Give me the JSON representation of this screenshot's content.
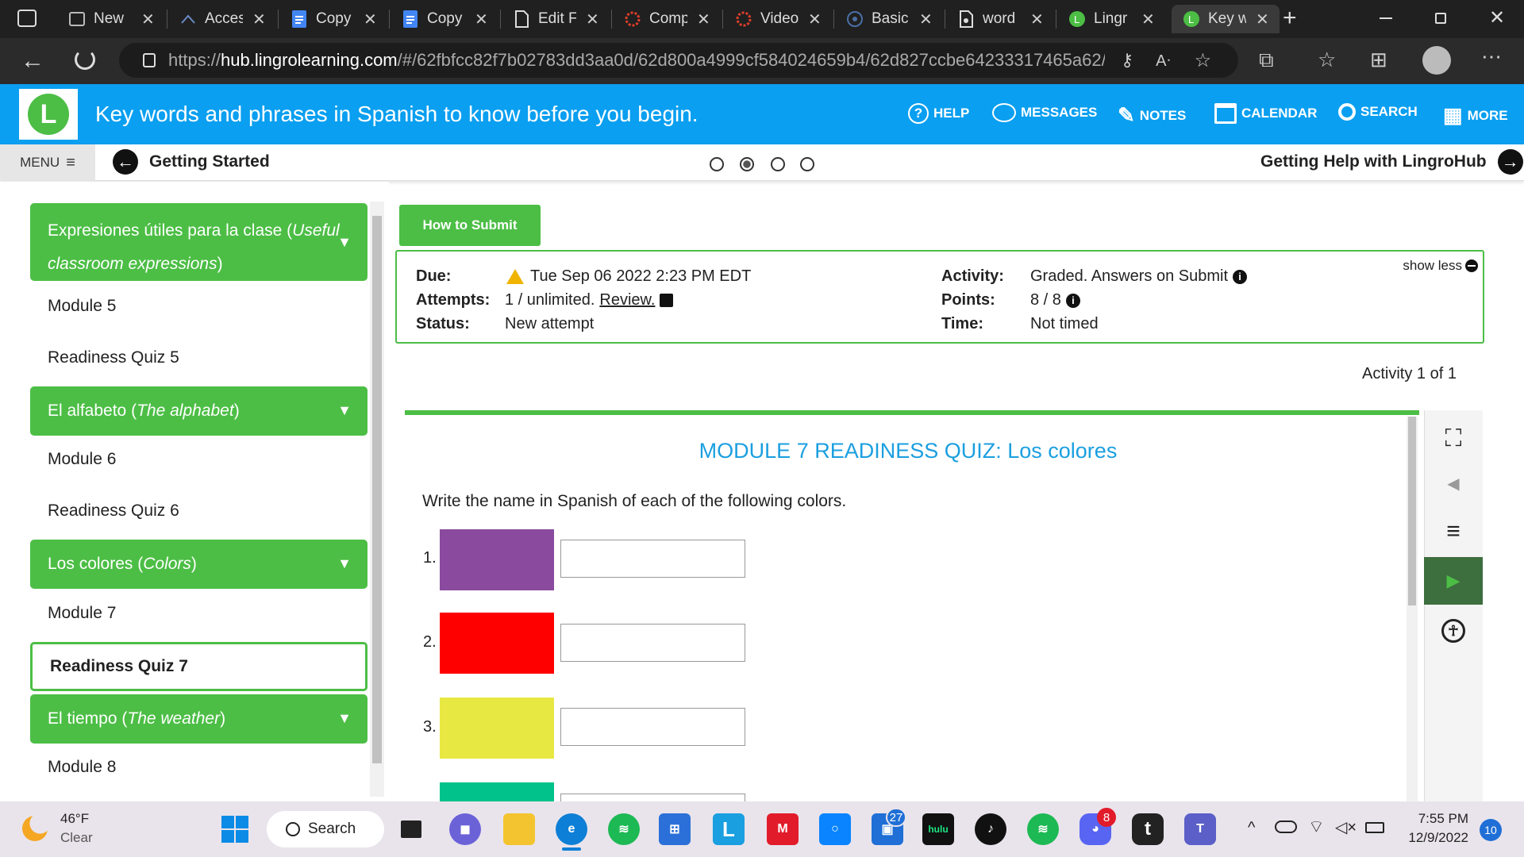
{
  "browser": {
    "tabs": [
      {
        "title": "New"
      },
      {
        "title": "Acces"
      },
      {
        "title": "Copy"
      },
      {
        "title": "Copy"
      },
      {
        "title": "Edit F"
      },
      {
        "title": "Comp"
      },
      {
        "title": "Video"
      },
      {
        "title": "Basic"
      },
      {
        "title": "word"
      },
      {
        "title": "Lingr"
      },
      {
        "title": "Key w"
      }
    ],
    "url_prefix": "https://",
    "url_host": "hub.lingrolearning.com",
    "url_path": "/#/62fbfcc82f7b02783dd3aa0d/62d800a4999cf584024659b4/62d827ccbe64233317465a62/6..."
  },
  "header": {
    "logo_letter": "L",
    "title": "Key words and phrases in Spanish to know before you begin.",
    "nav": [
      "HELP",
      "MESSAGES",
      "NOTES",
      "CALENDAR",
      "SEARCH",
      "MORE"
    ]
  },
  "subbar": {
    "menu_label": "MENU",
    "prev_label": "Getting Started",
    "next_label": "Getting Help with LingroHub"
  },
  "sidebar": {
    "groups": [
      {
        "label_plain": "Expresiones útiles para la clase (",
        "label_italic": "Useful",
        "label_line2_italic": "classroom expressions",
        "label_end": ")"
      },
      {
        "label_plain": "El alfabeto (",
        "label_italic": "The alphabet",
        "label_end": ")"
      },
      {
        "label_plain": "Los colores (",
        "label_italic": "Colors",
        "label_end": ")"
      },
      {
        "label_plain": "El tiempo (",
        "label_italic": "The weather",
        "label_end": ")"
      }
    ],
    "items": [
      "Module 5",
      "Readiness Quiz 5",
      "Module 6",
      "Readiness Quiz 6",
      "Module 7",
      "Readiness Quiz 7",
      "Module 8"
    ]
  },
  "activity": {
    "submit_button": "How to Submit",
    "show_less": "show less",
    "due_label": "Due:",
    "due_value": "Tue Sep 06 2022 2:23 PM EDT",
    "attempts_label": "Attempts:",
    "attempts_value": "1 / unlimited.",
    "review_link": "Review.",
    "status_label": "Status:",
    "status_value": "New attempt",
    "activity_label": "Activity:",
    "activity_value": "Graded. Answers on Submit",
    "points_label": "Points:",
    "points_value": "8 / 8",
    "time_label": "Time:",
    "time_value": "Not timed",
    "counter": "Activity 1 of 1"
  },
  "quiz": {
    "title": "MODULE 7 READINESS QUIZ: Los colores",
    "instruction": "Write the name in Spanish of each of the following colors.",
    "questions": [
      {
        "number": "1.",
        "color": "#8a4a9e"
      },
      {
        "number": "2.",
        "color": "#ff0000"
      },
      {
        "number": "3.",
        "color": "#e8e843"
      },
      {
        "number": "",
        "color": "#00c28a"
      }
    ]
  },
  "taskbar": {
    "weather_temp": "46°F",
    "weather_desc": "Clear",
    "search_label": "Search",
    "time": "7:55 PM",
    "date": "12/9/2022",
    "notif_count": "10",
    "badge_teams": "27",
    "badge_discord": "8",
    "hulu_label": "hulu"
  },
  "colors": {
    "brand_blue": "#0a9ff0",
    "brand_green": "#4cbe45",
    "title_blue": "#1a9fe0"
  }
}
